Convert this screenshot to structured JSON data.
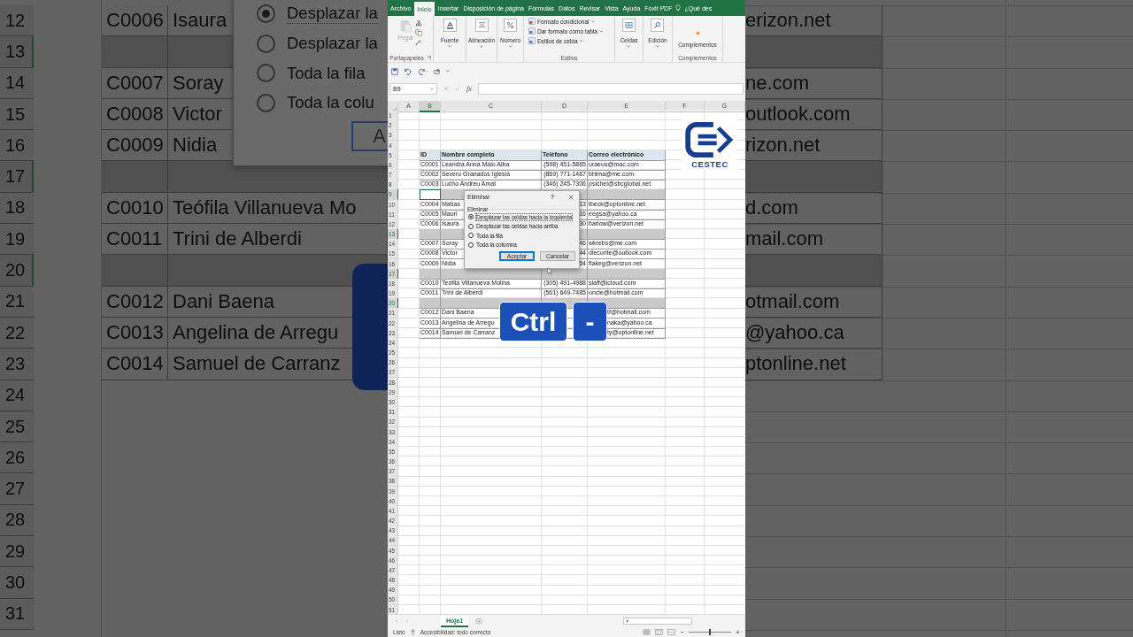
{
  "backdrop": {
    "rows": [
      {
        "number": "12",
        "selected": false,
        "kind": "data",
        "id": "C0006",
        "name": "Isaura",
        "email": "erizon.net"
      },
      {
        "number": "13",
        "selected": true,
        "kind": "data"
      },
      {
        "number": "14",
        "selected": false,
        "kind": "data",
        "id": "C0007",
        "name": "Soray",
        "email": "ne.com"
      },
      {
        "number": "15",
        "selected": false,
        "kind": "data",
        "id": "C0008",
        "name": "Victor",
        "email": "outlook.com"
      },
      {
        "number": "16",
        "selected": false,
        "kind": "data",
        "id": "C0009",
        "name": "Nidia",
        "email": "rizon.net"
      },
      {
        "number": "17",
        "selected": true,
        "kind": "data"
      },
      {
        "number": "18",
        "selected": false,
        "kind": "data",
        "id": "C0010",
        "name": "Teófila Villanueva Mo",
        "email": "d.com"
      },
      {
        "number": "19",
        "selected": false,
        "kind": "data",
        "id": "C0011",
        "name": "Trini de Alberdi",
        "email": "mail.com"
      },
      {
        "number": "20",
        "selected": true,
        "kind": "data"
      },
      {
        "number": "21",
        "selected": false,
        "kind": "data",
        "id": "C0012",
        "name": "Dani Baena",
        "email": "otmail.com"
      },
      {
        "number": "22",
        "selected": false,
        "kind": "data",
        "id": "C0013",
        "name": "Angelina de Arregu",
        "email": "@yahoo.ca"
      },
      {
        "number": "23",
        "selected": false,
        "kind": "data",
        "id": "C0014",
        "name": "Samuel de Carranz",
        "email": "ptonline.net"
      },
      {
        "number": "24",
        "selected": false,
        "kind": "blank"
      },
      {
        "number": "25",
        "selected": false,
        "kind": "blank"
      },
      {
        "number": "26",
        "selected": false,
        "kind": "blank"
      },
      {
        "number": "27",
        "selected": false,
        "kind": "blank"
      },
      {
        "number": "28",
        "selected": false,
        "kind": "blank"
      },
      {
        "number": "29",
        "selected": false,
        "kind": "blank"
      },
      {
        "number": "30",
        "selected": false,
        "kind": "blank"
      },
      {
        "number": "31",
        "selected": false,
        "kind": "blank"
      }
    ],
    "dialog": {
      "options": [
        {
          "label": "Desplazar la",
          "selected": true
        },
        {
          "label": "Desplazar la",
          "selected": false
        },
        {
          "label": "Toda la fila",
          "selected": false
        },
        {
          "label": "Toda la colu",
          "selected": false
        }
      ],
      "button": "A"
    }
  },
  "ribbon": {
    "tabs": [
      {
        "label": "Archivo",
        "selected": false
      },
      {
        "label": "Inicio",
        "selected": true
      },
      {
        "label": "Insertar",
        "selected": false
      },
      {
        "label": "Disposición de página",
        "selected": false
      },
      {
        "label": "Fórmulas",
        "selected": false
      },
      {
        "label": "Datos",
        "selected": false
      },
      {
        "label": "Revisar",
        "selected": false
      },
      {
        "label": "Vista",
        "selected": false
      },
      {
        "label": "Ayuda",
        "selected": false
      },
      {
        "label": "Foxit PDF",
        "selected": false
      }
    ],
    "search": "¿Qué des",
    "groups": [
      {
        "kind": "clipboard",
        "label": "Portapapeles",
        "commands": [
          {
            "label": "Pegar",
            "disabled": true
          }
        ]
      },
      {
        "kind": "menu",
        "commands": [
          {
            "label": "Fuente",
            "disabled": false
          }
        ]
      },
      {
        "kind": "menu",
        "commands": [
          {
            "label": "Alineación",
            "disabled": false
          }
        ]
      },
      {
        "kind": "menu",
        "commands": [
          {
            "label": "Número",
            "disabled": false
          }
        ]
      },
      {
        "kind": "list",
        "label": "Estilos",
        "commands": [
          {
            "label": "Formato condicional",
            "disabled": false
          },
          {
            "label": "Dar formato como tabla",
            "disabled": false
          },
          {
            "label": "Estilos de celda",
            "disabled": false
          }
        ]
      },
      {
        "kind": "menu",
        "commands": [
          {
            "label": "Celdas",
            "disabled": false
          }
        ]
      },
      {
        "kind": "menu",
        "commands": [
          {
            "label": "Edición",
            "disabled": false
          }
        ]
      },
      {
        "kind": "large",
        "label": "Complementos",
        "commands": [
          {
            "label": "Complementos",
            "disabled": false
          }
        ]
      }
    ]
  },
  "formula_bar": {
    "name_box": "B9",
    "function_label": "fx"
  },
  "sheet": {
    "columns": [
      {
        "label": "A",
        "selected": false
      },
      {
        "label": "B",
        "selected": true
      },
      {
        "label": "C",
        "selected": false
      },
      {
        "label": "D",
        "selected": false
      },
      {
        "label": "E",
        "selected": false
      },
      {
        "label": "F",
        "selected": false
      },
      {
        "label": "G",
        "selected": false
      }
    ],
    "rows": [
      {
        "number": "1",
        "selected": false,
        "kind": "blank",
        "active_cell": false
      },
      {
        "number": "2",
        "selected": false,
        "kind": "blank",
        "active_cell": false
      },
      {
        "number": "3",
        "selected": false,
        "kind": "blank",
        "active_cell": false
      },
      {
        "number": "4",
        "selected": false,
        "kind": "blank",
        "active_cell": false
      },
      {
        "number": "5",
        "selected": false,
        "kind": "header",
        "active_cell": false,
        "cells": {
          "id": "ID",
          "name": "Nombre completo",
          "phone": "Teléfono",
          "email": "Correo electrónico"
        }
      },
      {
        "number": "6",
        "selected": false,
        "kind": "data",
        "active_cell": false,
        "cells": {
          "id": "C0001",
          "name": "Leandra Anna Malo Alba",
          "phone": "(598) 451-5865",
          "email": "uraeus@mac.com"
        }
      },
      {
        "number": "7",
        "selected": false,
        "kind": "data",
        "active_cell": false,
        "cells": {
          "id": "C0002",
          "name": "Severo Granados Iglesia",
          "phone": "(869) 771-1487",
          "email": "bhima@me.com"
        }
      },
      {
        "number": "8",
        "selected": false,
        "kind": "data",
        "active_cell": false,
        "cells": {
          "id": "C0003",
          "name": "Lucho Andreu Amat",
          "phone": "(346) 245-7306",
          "email": "psichel@sbcglobal.net"
        }
      },
      {
        "number": "9",
        "selected": true,
        "kind": "data",
        "active_cell": true
      },
      {
        "number": "10",
        "selected": false,
        "kind": "data",
        "active_cell": false,
        "cells": {
          "id": "C0004",
          "name": "Matías",
          "phone": "13",
          "email": "tbeck@optonline.net"
        }
      },
      {
        "number": "11",
        "selected": false,
        "kind": "data",
        "active_cell": false,
        "cells": {
          "id": "C0005",
          "name": "Mauri",
          "phone": "16",
          "email": "eegsa@yahoo.ca"
        }
      },
      {
        "number": "12",
        "selected": false,
        "kind": "data",
        "active_cell": false,
        "cells": {
          "id": "C0006",
          "name": "Isaura",
          "phone": "30",
          "email": "barlow@verizon.net"
        }
      },
      {
        "number": "13",
        "selected": true,
        "kind": "data",
        "active_cell": false
      },
      {
        "number": "14",
        "selected": false,
        "kind": "data",
        "active_cell": false,
        "cells": {
          "id": "C0007",
          "name": "Soray",
          "phone": "46",
          "email": "wkrebs@me.com"
        }
      },
      {
        "number": "15",
        "selected": false,
        "kind": "data",
        "active_cell": false,
        "cells": {
          "id": "C0008",
          "name": "Victor",
          "phone": "44",
          "email": "dleconte@outlook.com"
        }
      },
      {
        "number": "16",
        "selected": false,
        "kind": "data",
        "active_cell": false,
        "cells": {
          "id": "C0009",
          "name": "Nidia",
          "phone": "54",
          "email": "flakeg@verizon.net"
        }
      },
      {
        "number": "17",
        "selected": true,
        "kind": "data",
        "active_cell": false
      },
      {
        "number": "18",
        "selected": false,
        "kind": "data",
        "active_cell": false,
        "cells": {
          "id": "C0010",
          "name": "Teófila Villanueva Molina",
          "phone": "(305) 491-4988",
          "email": "slaff@icloud.com"
        }
      },
      {
        "number": "19",
        "selected": false,
        "kind": "data",
        "active_cell": false,
        "cells": {
          "id": "C0011",
          "name": "Trini de Alberdi",
          "phone": "(561) 649-7485",
          "email": "uncle@hotmail.com"
        }
      },
      {
        "number": "20",
        "selected": true,
        "kind": "data",
        "active_cell": false
      },
      {
        "number": "21",
        "selected": false,
        "kind": "clipped",
        "active_cell": false,
        "cells": {
          "id": "C0012",
          "name": "Dani Baena",
          "email": "tf@hotmail.com"
        }
      },
      {
        "number": "22",
        "selected": false,
        "kind": "clipped",
        "active_cell": false,
        "cells": {
          "id": "C0013",
          "name": "Angelina de Arregu",
          "email": "naka@yahoo.ca"
        }
      },
      {
        "number": "23",
        "selected": false,
        "kind": "clipped",
        "active_cell": false,
        "cells": {
          "id": "C0014",
          "name": "Samuel de Carranz",
          "email": "ty@optonline.net"
        }
      },
      {
        "number": "24",
        "selected": false,
        "kind": "blank",
        "active_cell": false
      },
      {
        "number": "25",
        "selected": false,
        "kind": "blank",
        "active_cell": false
      },
      {
        "number": "26",
        "selected": false,
        "kind": "blank",
        "active_cell": false
      },
      {
        "number": "27",
        "selected": false,
        "kind": "blank",
        "active_cell": false
      },
      {
        "number": "28",
        "selected": false,
        "kind": "blank",
        "active_cell": false
      },
      {
        "number": "29",
        "selected": false,
        "kind": "blank",
        "active_cell": false
      },
      {
        "number": "30",
        "selected": false,
        "kind": "blank",
        "active_cell": false
      },
      {
        "number": "31",
        "selected": false,
        "kind": "blank",
        "active_cell": false
      },
      {
        "number": "32",
        "selected": false,
        "kind": "blank",
        "active_cell": false
      },
      {
        "number": "33",
        "selected": false,
        "kind": "blank",
        "active_cell": false
      },
      {
        "number": "34",
        "selected": false,
        "kind": "blank",
        "active_cell": false
      },
      {
        "number": "35",
        "selected": false,
        "kind": "blank",
        "active_cell": false
      },
      {
        "number": "36",
        "selected": false,
        "kind": "blank",
        "active_cell": false
      },
      {
        "number": "37",
        "selected": false,
        "kind": "blank",
        "active_cell": false
      },
      {
        "number": "38",
        "selected": false,
        "kind": "blank",
        "active_cell": false
      },
      {
        "number": "39",
        "selected": false,
        "kind": "blank",
        "active_cell": false
      },
      {
        "number": "40",
        "selected": false,
        "kind": "blank",
        "active_cell": false
      },
      {
        "number": "41",
        "selected": false,
        "kind": "blank",
        "active_cell": false
      },
      {
        "number": "42",
        "selected": false,
        "kind": "blank",
        "active_cell": false
      },
      {
        "number": "43",
        "selected": false,
        "kind": "blank",
        "active_cell": false
      },
      {
        "number": "44",
        "selected": false,
        "kind": "blank",
        "active_cell": false
      },
      {
        "number": "45",
        "selected": false,
        "kind": "blank",
        "active_cell": false
      },
      {
        "number": "46",
        "selected": false,
        "kind": "blank",
        "active_cell": false
      },
      {
        "number": "47",
        "selected": false,
        "kind": "blank",
        "active_cell": false
      },
      {
        "number": "48",
        "selected": false,
        "kind": "blank",
        "active_cell": false
      },
      {
        "number": "49",
        "selected": false,
        "kind": "blank",
        "active_cell": false
      },
      {
        "number": "50",
        "selected": false,
        "kind": "blank",
        "active_cell": false
      },
      {
        "number": "51",
        "selected": false,
        "kind": "blank",
        "active_cell": false
      }
    ]
  },
  "dialog": {
    "title": "Eliminar",
    "help": "?",
    "group": "Eliminar",
    "options": [
      {
        "label": "Desplazar las celdas hacia la izquierda",
        "selected": true
      },
      {
        "label": "Desplazar las celdas hacia arriba",
        "selected": false
      },
      {
        "label": "Toda la fila",
        "selected": false
      },
      {
        "label": "Toda la columna",
        "selected": false
      }
    ],
    "buttons": [
      {
        "label": "Aceptar",
        "default": true
      },
      {
        "label": "Cancelar",
        "default": false
      }
    ]
  },
  "keys": [
    "Ctrl",
    "-"
  ],
  "logo": {
    "text": "CESTEC"
  },
  "sheet_tabs": [
    {
      "label": "Hoja1",
      "selected": true
    }
  ],
  "status_bar": {
    "ready": "Listo",
    "accessibility": "Accesibilidad: todo correcto",
    "zoom": {
      "level": 0.5
    }
  }
}
